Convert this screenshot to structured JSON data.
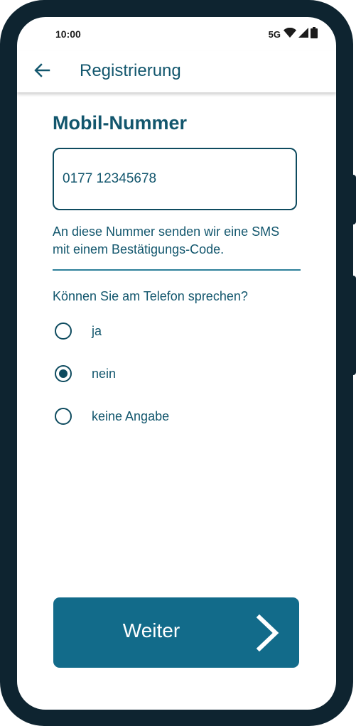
{
  "status_bar": {
    "time": "10:00",
    "network": "5G",
    "icons": [
      "wifi-icon",
      "signal-icon",
      "battery-icon"
    ]
  },
  "app_bar": {
    "title": "Registrierung",
    "back_icon": "arrow-left-icon"
  },
  "form": {
    "section_title": "Mobil-Nummer",
    "phone_value": "0177 12345678",
    "helper_text": "An diese Nummer senden wir eine SMS mit einem Bestätigungs-Code.",
    "question": "Können Sie am Telefon sprechen?",
    "options": [
      {
        "label": "ja",
        "selected": false
      },
      {
        "label": "nein",
        "selected": true
      },
      {
        "label": "keine Angabe",
        "selected": false
      }
    ]
  },
  "actions": {
    "next_label": "Weiter",
    "next_icon": "chevron-right-icon"
  },
  "colors": {
    "primary": "#12566d",
    "button": "#126b8a",
    "frame": "#0e2430"
  }
}
